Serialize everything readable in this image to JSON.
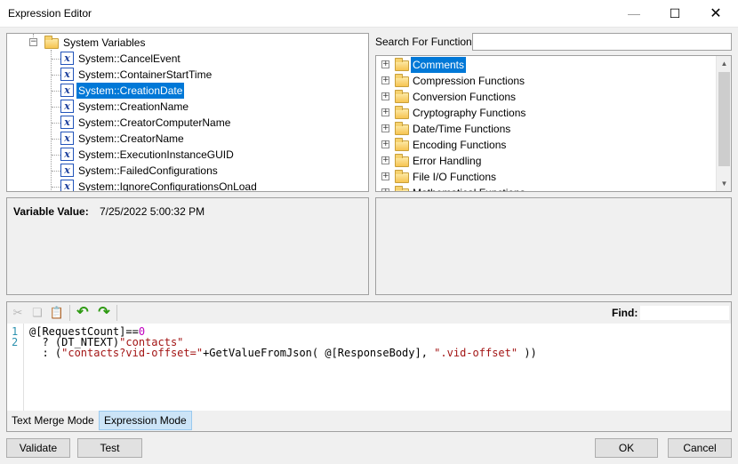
{
  "window": {
    "title": "Expression Editor"
  },
  "variables": {
    "group": "System Variables",
    "items": [
      "System::CancelEvent",
      "System::ContainerStartTime",
      "System::CreationDate",
      "System::CreationName",
      "System::CreatorComputerName",
      "System::CreatorName",
      "System::ExecutionInstanceGUID",
      "System::FailedConfigurations",
      "System::IgnoreConfigurationsOnLoad"
    ],
    "selected": "System::CreationDate"
  },
  "search": {
    "label": "Search For Function:",
    "value": ""
  },
  "functions": {
    "items": [
      "Comments",
      "Compression Functions",
      "Conversion Functions",
      "Cryptography Functions",
      "Date/Time Functions",
      "Encoding Functions",
      "Error Handling",
      "File I/O Functions",
      "Mathematical Functions"
    ],
    "selected": "Comments"
  },
  "variable_value": {
    "label": "Variable Value:",
    "value": "7/25/2022 5:00:32 PM"
  },
  "editor": {
    "find_label": "Find:",
    "line_numbers": [
      "1",
      "2"
    ],
    "code": {
      "l1_a": "@[RequestCount]==",
      "l1_num": "0",
      "l2_a": "  ? (DT_NTEXT)",
      "l2_str": "\"contacts\"",
      "l3_a": "  : (",
      "l3_str1": "\"contacts?vid-offset=\"",
      "l3_b": "+GetValueFromJson( @[ResponseBody], ",
      "l3_str2": "\".vid-offset\"",
      "l3_c": " ))"
    },
    "modes": [
      "Text Merge Mode",
      "Expression Mode"
    ],
    "active_mode": "Expression Mode"
  },
  "buttons": {
    "validate": "Validate",
    "test": "Test",
    "ok": "OK",
    "cancel": "Cancel"
  },
  "toolbar_icons": [
    "cut-icon",
    "copy-icon",
    "paste-icon",
    "undo-icon",
    "redo-icon"
  ]
}
